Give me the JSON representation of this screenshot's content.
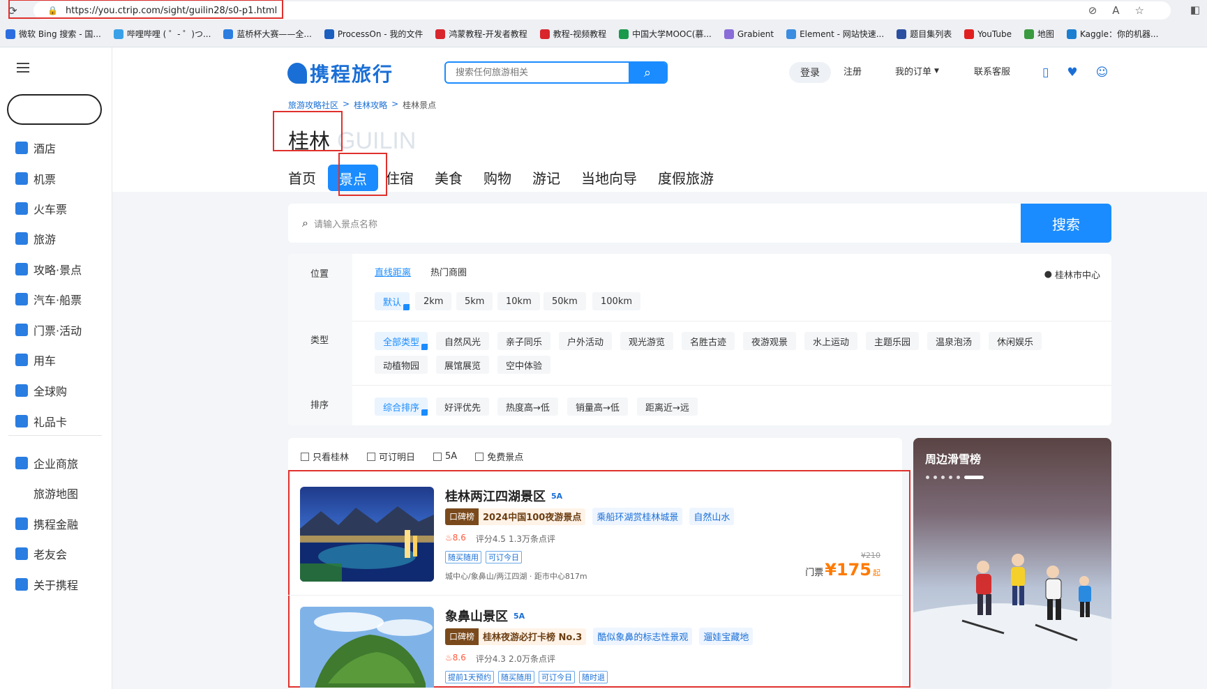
{
  "browser": {
    "url": "https://you.ctrip.com/sight/guilin28/s0-p1.html",
    "bookmarks": [
      "微软 Bing 搜索 - 国...",
      "哔哩哔哩 ( ゜- ゜)つ...",
      "蓝桥杯大赛——全...",
      "ProcessOn - 我的文件",
      "鸿蒙教程-开发者教程",
      "教程-视频教程",
      "中国大学MOOC(慕...",
      "Grabient",
      "Element - 网站快速...",
      "题目集列表",
      "YouTube",
      "地图",
      "Kaggle：你的机器..."
    ],
    "bookmark_colors": [
      "#2b6de0",
      "#3aa0e8",
      "#2b7de0",
      "#1b5fbf",
      "#d8262c",
      "#d8262c",
      "#1a9a4a",
      "#8a6cd8",
      "#3a8de0",
      "#2b4fa0",
      "#e02020",
      "#3a9a40",
      "#1a7fd0"
    ]
  },
  "sidebar": {
    "items": [
      {
        "label": "酒店",
        "color": "#2a7de1"
      },
      {
        "label": "机票",
        "color": "#2a7de1"
      },
      {
        "label": "火车票",
        "color": "#2a7de1"
      },
      {
        "label": "旅游",
        "color": "#2a7de1"
      },
      {
        "label": "攻略·景点",
        "color": "#2a7de1"
      },
      {
        "label": "汽车·船票",
        "color": "#2a7de1"
      },
      {
        "label": "门票·活动",
        "color": "#2a7de1"
      },
      {
        "label": "用车",
        "color": "#2a7de1"
      },
      {
        "label": "全球购",
        "color": "#2a7de1"
      },
      {
        "label": "礼品卡",
        "color": "#2a7de1"
      },
      {
        "label": "企业商旅",
        "color": "#2a7de1"
      },
      {
        "label": "旅游地图",
        "color": ""
      },
      {
        "label": "携程金融",
        "color": "#2a7de1"
      },
      {
        "label": "老友会",
        "color": "#2a7de1"
      },
      {
        "label": "关于携程",
        "color": "#2a7de1"
      }
    ]
  },
  "header": {
    "logo": "携程旅行",
    "search_placeholder": "搜索任何旅游相关",
    "login": "登录",
    "register": "注册",
    "orders": "我的订单",
    "service": "联系客服"
  },
  "breadcrumb": [
    "旅游攻略社区",
    "桂林攻略",
    "桂林景点"
  ],
  "city": {
    "cn": "桂林",
    "en": "GUILIN"
  },
  "tabs": [
    "首页",
    "景点",
    "住宿",
    "美食",
    "购物",
    "游记",
    "当地向导",
    "度假旅游"
  ],
  "active_tab": "景点",
  "scenic_search": {
    "placeholder": "请输入景点名称",
    "button": "搜索"
  },
  "filters": {
    "location_label": "位置",
    "location_tabs": [
      "直线距离",
      "热门商圈"
    ],
    "distances": [
      "默认",
      "2km",
      "5km",
      "10km",
      "50km",
      "100km"
    ],
    "center": "桂林市中心",
    "type_label": "类型",
    "types": [
      "全部类型",
      "自然风光",
      "亲子同乐",
      "户外活动",
      "观光游览",
      "名胜古迹",
      "夜游观景",
      "水上运动",
      "主题乐园",
      "温泉泡汤",
      "休闲娱乐",
      "动植物园",
      "展馆展览",
      "空中体验"
    ],
    "sort_label": "排序",
    "sorts": [
      "综合排序",
      "好评优先",
      "热度高→低",
      "销量高→低",
      "距离近→远"
    ]
  },
  "checkboxes": [
    "只看桂林",
    "可订明日",
    "5A",
    "免费景点"
  ],
  "items": [
    {
      "name": "桂林两江四湖景区",
      "level": "5A",
      "rank_key": "口碑榜",
      "rank_text": "2024中国100夜游景点",
      "highlights": [
        "乘船环湖赏桂林城景",
        "自然山水"
      ],
      "heat": "8.6",
      "score": "评分4.5",
      "reviews": "1.3万条点评",
      "services": [
        "随买随用",
        "可订今日"
      ],
      "address": "城中心/象鼻山/两江四湖 · 距市中心817m",
      "old_price": "¥210",
      "ticket_label": "门票",
      "price": "¥175",
      "price_suffix": "起"
    },
    {
      "name": "象鼻山景区",
      "level": "5A",
      "rank_key": "口碑榜",
      "rank_text": "桂林夜游必打卡榜 No.3",
      "highlights": [
        "酷似象鼻的标志性景观",
        "遛娃宝藏地"
      ],
      "heat": "8.6",
      "score": "评分4.3",
      "reviews": "2.0万条点评",
      "services": [
        "提前1天预约",
        "随买随用",
        "可订今日",
        "随时退"
      ]
    }
  ],
  "promo": {
    "title": "周边滑雪榜"
  }
}
